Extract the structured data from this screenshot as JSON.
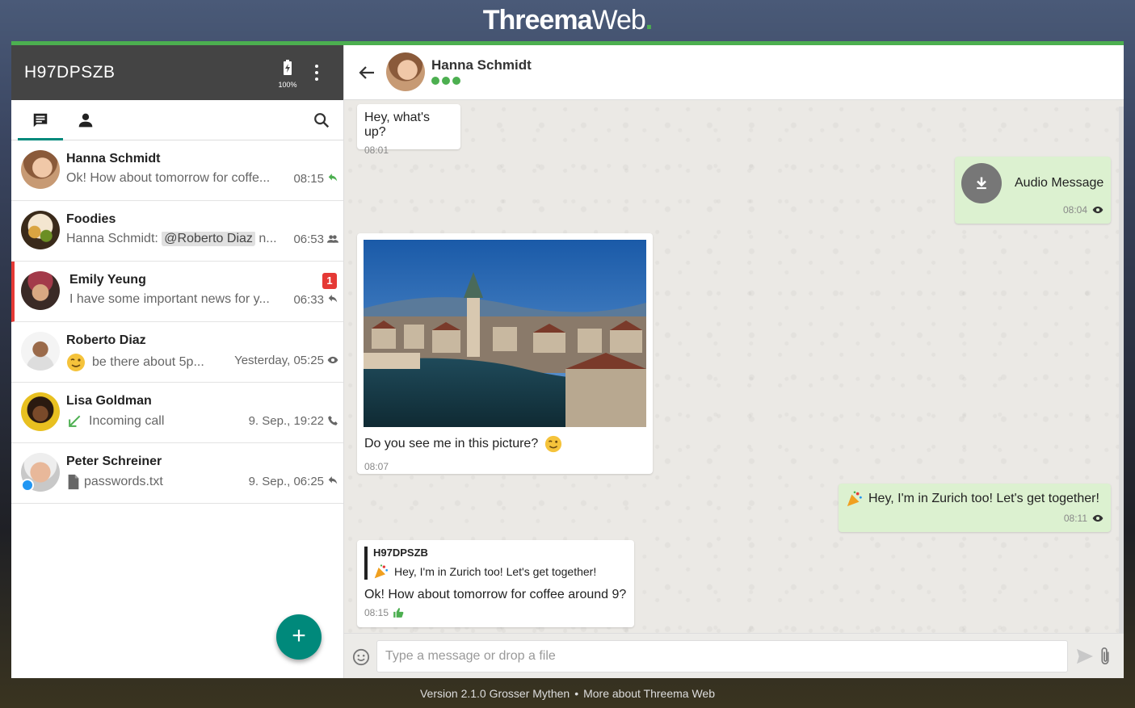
{
  "logo": {
    "bold": "Threema",
    "light": "Web",
    "dot": "."
  },
  "sidebar": {
    "identity": "H97DPSZB",
    "battery_pct": "100%",
    "conversations": [
      {
        "name": "Hanna Schmidt",
        "preview": "Ok! How about tomorrow for coffe...",
        "time": "08:15",
        "status_icon": "reply-icon"
      },
      {
        "name": "Foodies",
        "preview_prefix": "Hanna Schmidt: ",
        "mention": "@Roberto Diaz",
        "preview_suffix": " n...",
        "time": "06:53",
        "status_icon": "group-icon"
      },
      {
        "name": "Emily Yeung",
        "preview": "I have some important news for y...",
        "time": "06:33",
        "unread": "1",
        "status_icon": "reply-icon"
      },
      {
        "name": "Roberto Diaz",
        "preview": "be there about 5p...",
        "time": "Yesterday, 05:25",
        "status_icon": "eye-icon"
      },
      {
        "name": "Lisa Goldman",
        "preview": "Incoming call",
        "time": "9. Sep., 19:22",
        "status_icon": "phone-icon"
      },
      {
        "name": "Peter Schreiner",
        "preview": "passwords.txt",
        "time": "9. Sep., 06:25",
        "status_icon": "reply-icon"
      }
    ],
    "fab_label": "+"
  },
  "chat": {
    "contact_name": "Hanna Schmidt",
    "messages": [
      {
        "text": "Hey, what's up?",
        "time": "08:01"
      },
      {
        "label": "Audio Message",
        "time": "08:04"
      },
      {
        "text": "Do you see me in this picture?",
        "time": "08:07"
      },
      {
        "text": "Hey, I'm in Zurich too! Let's get together!",
        "time": "08:11"
      },
      {
        "quote_author": "H97DPSZB",
        "quote_text": "Hey, I'm in Zurich too! Let's get together!",
        "text": "Ok! How about tomorrow for coffee around 9?",
        "time": "08:15"
      }
    ],
    "composer": {
      "placeholder": "Type a message or drop a file"
    }
  },
  "footer": {
    "version": "Version 2.1.0 Grosser Mythen",
    "separator": "•",
    "link": "More about Threema Web"
  },
  "colors": {
    "accent": "#4caf50",
    "teal": "#00897b",
    "header": "#444444",
    "outgoing": "#dcf1d0",
    "unread": "#e53935"
  }
}
